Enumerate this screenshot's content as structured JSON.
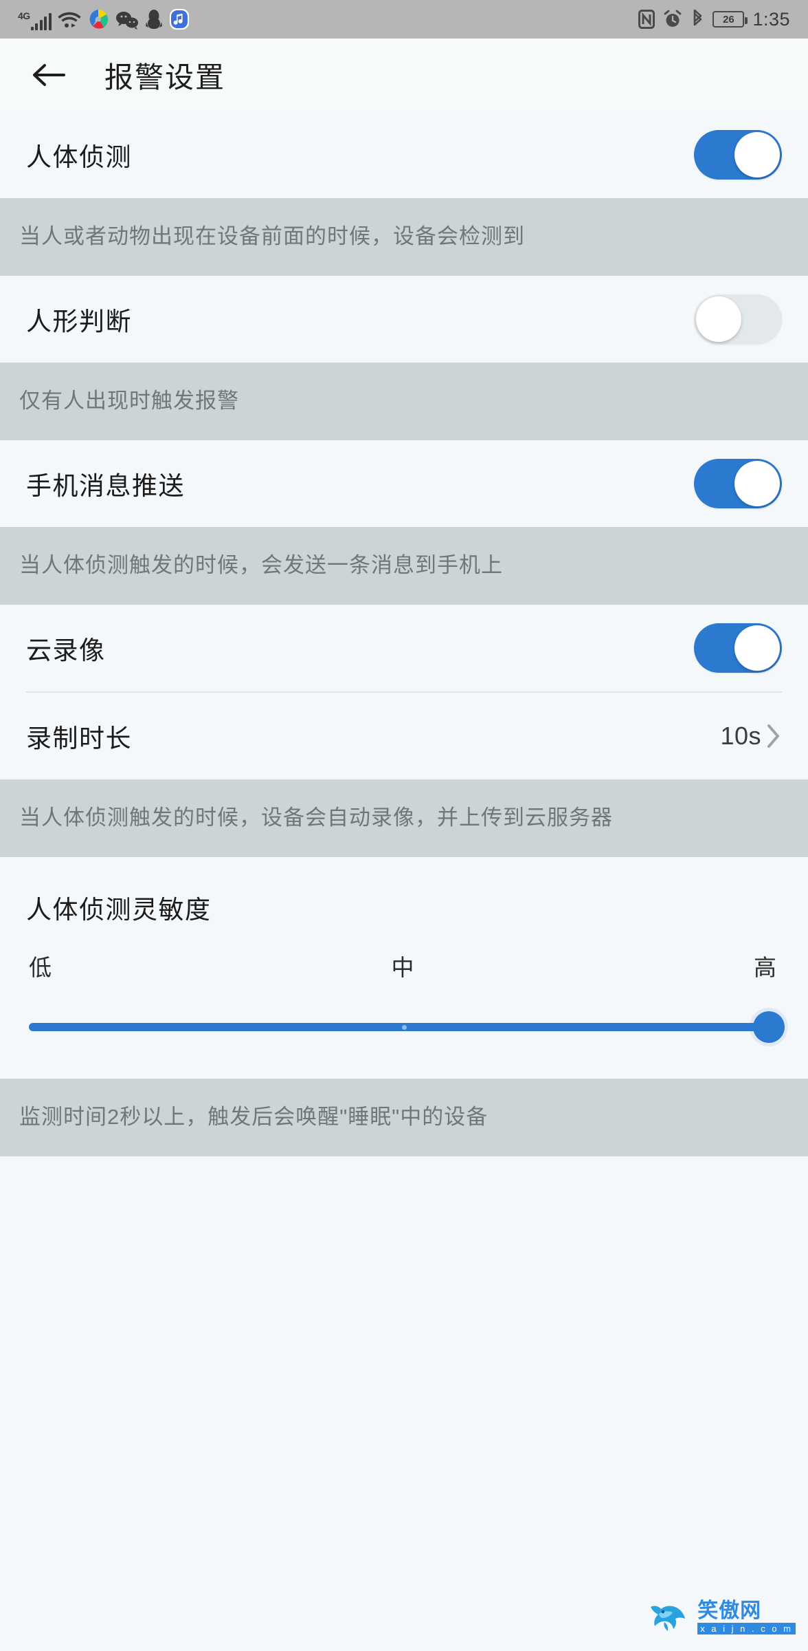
{
  "status_bar": {
    "network_label": "4G",
    "icons_left": [
      "signal-bars-icon",
      "wifi-icon",
      "colorful-app-icon",
      "wechat-icon",
      "qq-penguin-icon",
      "music-app-icon"
    ],
    "icons_right": [
      "nfc-icon",
      "alarm-clock-icon",
      "bluetooth-icon"
    ],
    "battery_level": "26",
    "time": "1:35"
  },
  "header": {
    "back_label": "←",
    "title": "报警设置"
  },
  "settings": [
    {
      "label": "人体侦测",
      "toggle_state": "on",
      "description": "当人或者动物出现在设备前面的时候，设备会检测到"
    },
    {
      "label": "人形判断",
      "toggle_state": "off",
      "description": "仅有人出现时触发报警"
    },
    {
      "label": "手机消息推送",
      "toggle_state": "on",
      "description": "当人体侦测触发的时候，会发送一条消息到手机上"
    }
  ],
  "cloud_group": {
    "toggle_row": {
      "label": "云录像",
      "toggle_state": "on"
    },
    "duration_row": {
      "label": "录制时长",
      "value": "10s",
      "chevron": "chevron-right-icon"
    },
    "description": "当人体侦测触发的时候，设备会自动录像，并上传到云服务器"
  },
  "sensitivity": {
    "title": "人体侦测灵敏度",
    "scale_labels": [
      "低",
      "中",
      "高"
    ],
    "value_percent": 100,
    "tick_percent": 50,
    "description": "监测时间2秒以上，触发后会唤醒\"睡眠\"中的设备"
  },
  "watermark": {
    "brand_cn": "笑傲网",
    "brand_url": "x a i j n . c o m",
    "logo": "shark-logo-icon"
  },
  "colors": {
    "accent_blue": "#2c79d0",
    "status_bar_bg": "#b6b6b6",
    "row_bg": "#f4f8fb",
    "desc_bg": "#ccd5d5",
    "desc_text": "#6f7878"
  }
}
